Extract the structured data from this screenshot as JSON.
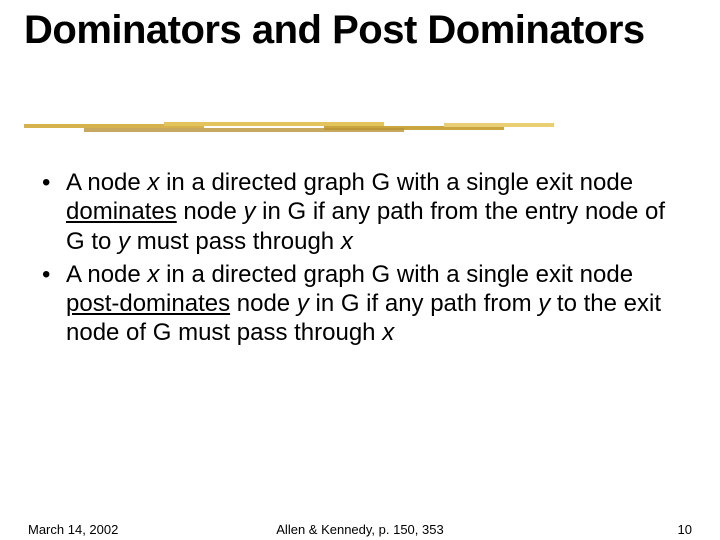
{
  "title": "Dominators and Post Dominators",
  "bullets": [
    {
      "pre1": "A node ",
      "x1": "x",
      "mid1": " in a directed graph G with a single exit node ",
      "term": "dominates",
      "mid2": " node ",
      "y1": "y",
      "mid3": " in G if any path from the entry node of G to ",
      "y2": "y",
      "mid4": " must pass through ",
      "x2": "x"
    },
    {
      "pre1": "A node ",
      "x1": "x",
      "mid1": " in a directed graph G with a single exit node ",
      "term": "post-dominates",
      "mid2": " node ",
      "y1": "y",
      "mid3": " in G if any path from ",
      "y2": "y",
      "mid4": " to the exit node of G must pass through ",
      "x2": "x"
    }
  ],
  "footer": {
    "date": "March 14, 2002",
    "center": "Allen & Kennedy, p. 150, 353",
    "page": "10"
  }
}
